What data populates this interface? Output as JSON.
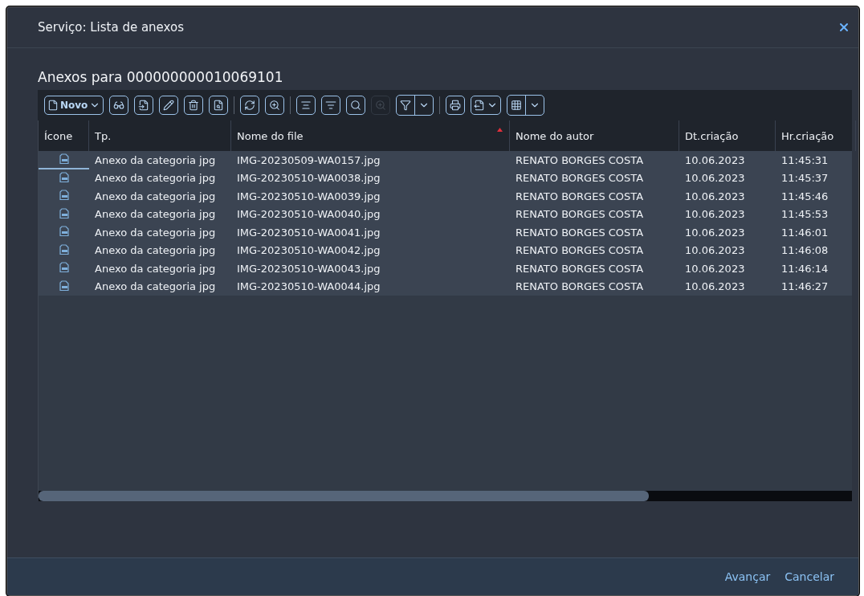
{
  "dialog": {
    "title": "Serviço: Lista de anexos",
    "heading": "Anexos para 000000000010069101"
  },
  "toolbar": [
    {
      "kind": "menu",
      "label": "Novo"
    },
    {
      "kind": "button",
      "disabled": false
    },
    {
      "kind": "button",
      "disabled": false
    },
    {
      "kind": "button",
      "disabled": false
    },
    {
      "kind": "button",
      "disabled": false
    },
    {
      "kind": "button",
      "disabled": false
    },
    {
      "kind": "separator"
    },
    {
      "kind": "button",
      "disabled": false
    },
    {
      "kind": "button",
      "disabled": false
    },
    {
      "kind": "separator"
    },
    {
      "kind": "button",
      "disabled": false
    },
    {
      "kind": "button",
      "disabled": false
    },
    {
      "kind": "button",
      "disabled": false
    },
    {
      "kind": "button",
      "disabled": true
    },
    {
      "kind": "split"
    },
    {
      "kind": "separator"
    },
    {
      "kind": "button",
      "disabled": false
    },
    {
      "kind": "menu"
    },
    {
      "kind": "split"
    }
  ],
  "table": {
    "columns": [
      {
        "label": "Ícone",
        "sorted": false
      },
      {
        "label": "Tp.",
        "sorted": false
      },
      {
        "label": "Nome do file",
        "sorted": true
      },
      {
        "label": "Nome do autor",
        "sorted": false
      },
      {
        "label": "Dt.criação",
        "sorted": false
      },
      {
        "label": "Hr.criação",
        "sorted": false
      }
    ],
    "rows": [
      {
        "focused": true,
        "type": "Anexo da categoria jpg",
        "file": "IMG-20230509-WA0157.jpg",
        "author": "RENATO BORGES COSTA",
        "date": "10.06.2023",
        "time": "11:45:31"
      },
      {
        "focused": false,
        "type": "Anexo da categoria jpg",
        "file": "IMG-20230510-WA0038.jpg",
        "author": "RENATO BORGES COSTA",
        "date": "10.06.2023",
        "time": "11:45:37"
      },
      {
        "focused": false,
        "type": "Anexo da categoria jpg",
        "file": "IMG-20230510-WA0039.jpg",
        "author": "RENATO BORGES COSTA",
        "date": "10.06.2023",
        "time": "11:45:46"
      },
      {
        "focused": false,
        "type": "Anexo da categoria jpg",
        "file": "IMG-20230510-WA0040.jpg",
        "author": "RENATO BORGES COSTA",
        "date": "10.06.2023",
        "time": "11:45:53"
      },
      {
        "focused": false,
        "type": "Anexo da categoria jpg",
        "file": "IMG-20230510-WA0041.jpg",
        "author": "RENATO BORGES COSTA",
        "date": "10.06.2023",
        "time": "11:46:01"
      },
      {
        "focused": false,
        "type": "Anexo da categoria jpg",
        "file": "IMG-20230510-WA0042.jpg",
        "author": "RENATO BORGES COSTA",
        "date": "10.06.2023",
        "time": "11:46:08"
      },
      {
        "focused": false,
        "type": "Anexo da categoria jpg",
        "file": "IMG-20230510-WA0043.jpg",
        "author": "RENATO BORGES COSTA",
        "date": "10.06.2023",
        "time": "11:46:14"
      },
      {
        "focused": false,
        "type": "Anexo da categoria jpg",
        "file": "IMG-20230510-WA0044.jpg",
        "author": "RENATO BORGES COSTA",
        "date": "10.06.2023",
        "time": "11:46:27"
      }
    ]
  },
  "footer": {
    "buttons": [
      "Avançar",
      "Cancelar"
    ]
  }
}
